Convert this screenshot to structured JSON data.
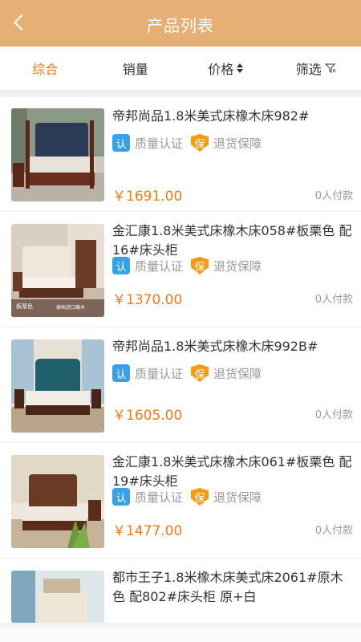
{
  "header": {
    "title": "产品列表"
  },
  "sort_tabs": [
    {
      "label": "综合"
    },
    {
      "label": "销量"
    },
    {
      "label": "价格"
    },
    {
      "label": "筛选"
    }
  ],
  "tags": {
    "auth_icon": "认",
    "auth_label": "质量认证",
    "guard_icon": "保",
    "guard_label": "退货保障"
  },
  "products": [
    {
      "name": "帝邦尚品1.8米美式床橡木床982#",
      "price": "￥1691.00",
      "sold": "0人付款"
    },
    {
      "name": "金汇康1.8米美式床橡木床058#板栗色 配16#床头柜",
      "price": "￥1370.00",
      "sold": "0人付款",
      "badge1": "板栗色",
      "badge2": "泰国进口橡木"
    },
    {
      "name": "帝邦尚品1.8米美式床橡木床992B#",
      "price": "￥1605.00",
      "sold": "0人付款"
    },
    {
      "name": "金汇康1.8米美式床橡木床061#板栗色 配19#床头柜",
      "price": "￥1477.00",
      "sold": "0人付款"
    },
    {
      "name": "都市王子1.8米橡木床美式床2061#原木色 配802#床头柜 原+白"
    }
  ]
}
